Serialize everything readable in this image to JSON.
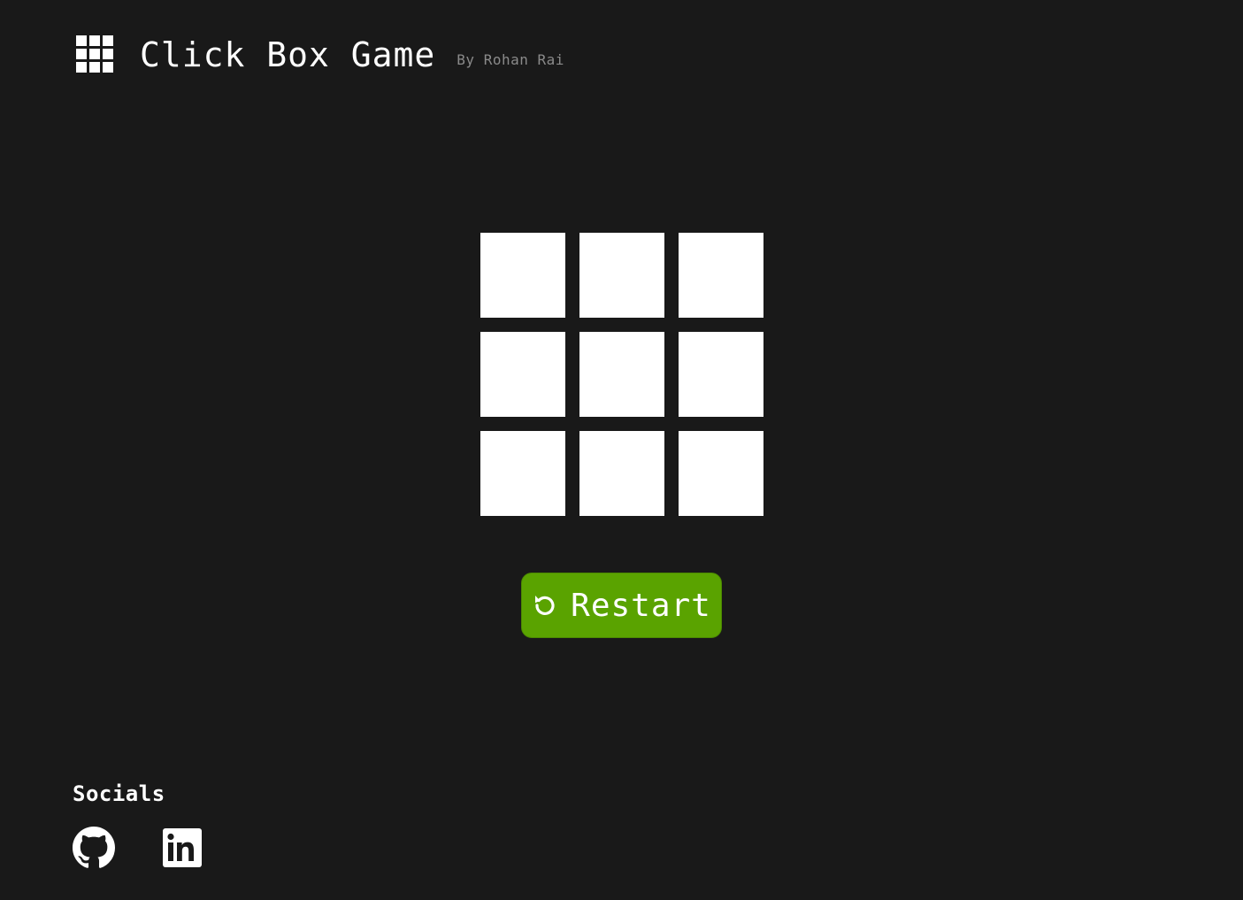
{
  "header": {
    "logo_icon": "grid-icon",
    "title": "Click Box Game",
    "byline": "By Rohan Rai"
  },
  "board": {
    "rows": 3,
    "cols": 3,
    "cell_color": "#ffffff",
    "cells": [
      "",
      "",
      "",
      "",
      "",
      "",
      "",
      "",
      ""
    ]
  },
  "restart": {
    "label": "Restart",
    "icon": "restart-icon",
    "color": "#5aa300"
  },
  "socials": {
    "title": "Socials",
    "links": [
      {
        "name": "github",
        "icon": "github-icon"
      },
      {
        "name": "linkedin",
        "icon": "linkedin-icon"
      }
    ]
  },
  "colors": {
    "background": "#191919",
    "text": "#ffffff",
    "byline": "#8a8a8a",
    "accent": "#5aa300"
  }
}
